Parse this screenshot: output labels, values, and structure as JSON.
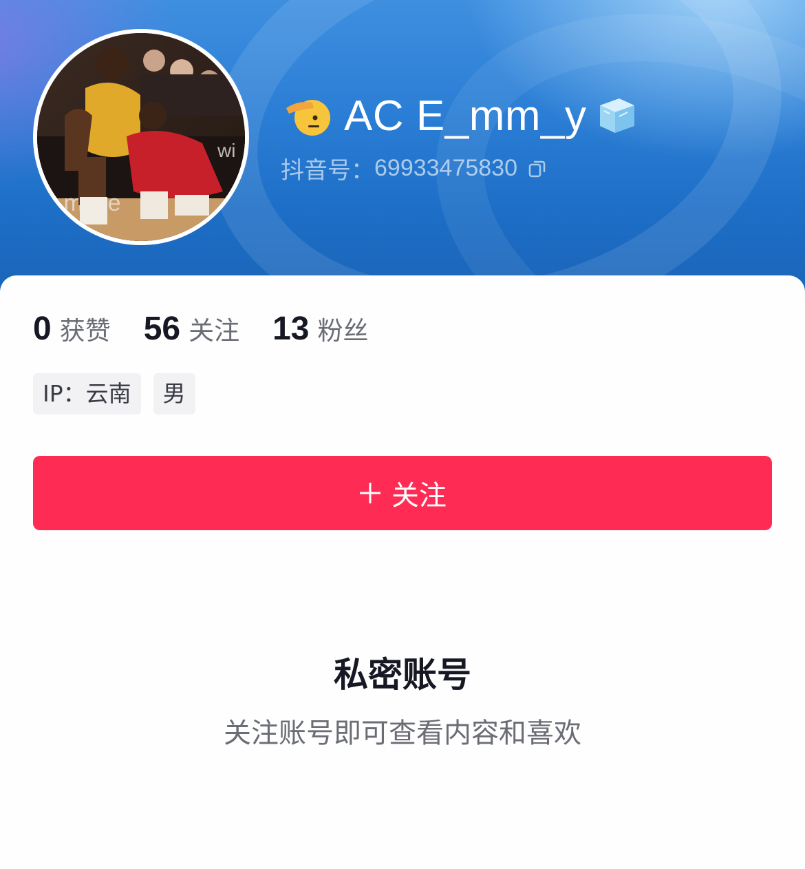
{
  "profile": {
    "name": "AC E_mm_y",
    "id_label": "抖音号：",
    "id_value": "69933475830",
    "avatar_icon": "avatar-photo-basketball",
    "name_emoji_left": "saluting-face-emoji",
    "name_emoji_right": "ice-cube-emoji"
  },
  "stats": [
    {
      "value": "0",
      "label": "获赞"
    },
    {
      "value": "56",
      "label": "关注"
    },
    {
      "value": "13",
      "label": "粉丝"
    }
  ],
  "tags": [
    {
      "label": "IP：云南"
    },
    {
      "label": "男"
    }
  ],
  "follow_button": {
    "label": "关注",
    "icon": "plus-icon"
  },
  "private_notice": {
    "title": "私密账号",
    "subtitle": "关注账号即可查看内容和喜欢"
  },
  "colors": {
    "accent": "#fe2c55",
    "header_blue": "#2c7fd6",
    "text_primary": "#161823",
    "text_secondary": "#6b6d75"
  }
}
